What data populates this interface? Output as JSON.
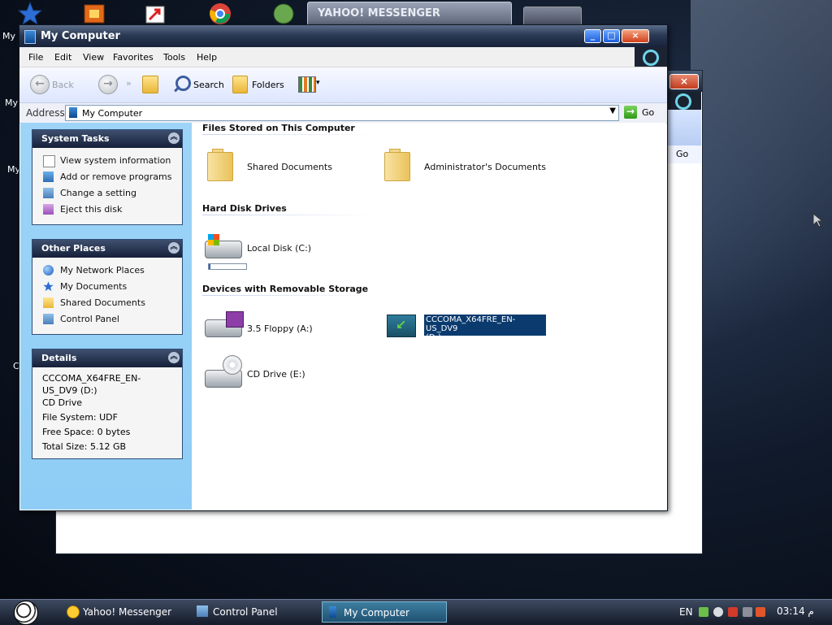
{
  "desktop": {
    "labels": [
      "My I",
      "My",
      "My",
      "C"
    ],
    "ym_tab": "YAHOO! MESSENGER"
  },
  "window": {
    "title": "My Computer",
    "controls": {
      "minimize": "_",
      "maximize": "□",
      "close": "×"
    }
  },
  "menu": [
    "File",
    "Edit",
    "View",
    "Favorites",
    "Tools",
    "Help"
  ],
  "toolbar": {
    "back": "Back",
    "forward": "»",
    "search": "Search",
    "folders": "Folders"
  },
  "address": {
    "label": "Address",
    "value": "My Computer",
    "go": "Go"
  },
  "system_tasks": {
    "title": "System Tasks",
    "items": [
      "View system information",
      "Add or remove programs",
      "Change a setting",
      "Eject this disk"
    ]
  },
  "other_places": {
    "title": "Other Places",
    "items": [
      "My Network Places",
      "My Documents",
      "Shared Documents",
      "Control Panel"
    ]
  },
  "details": {
    "title": "Details",
    "name": "CCCOMA_X64FRE_EN-US_DV9 (D:)",
    "type": "CD Drive",
    "file_system": "File System: UDF",
    "free_space": "Free Space: 0 bytes",
    "total_size": "Total Size: 5.12 GB"
  },
  "sections": {
    "files": "Files Stored on This Computer",
    "hdd": "Hard Disk Drives",
    "removable": "Devices with Removable Storage"
  },
  "items": {
    "shared_docs": "Shared Documents",
    "admin_docs": "Administrator's Documents",
    "local_disk": "Local Disk (C:)",
    "local_disk_used_fraction": 0.05,
    "floppy": "3.5 Floppy (A:)",
    "usb_line1": "CCCOMA_X64FRE_EN-US_DV9",
    "usb_line2": "(D:)",
    "cd_drive": "CD Drive (E:)"
  },
  "taskbar": {
    "items": [
      "Yahoo! Messenger",
      "Control Panel",
      "My Computer"
    ],
    "language": "EN",
    "clock": "03:14",
    "tray_suffix": "م"
  },
  "colors": {
    "accent": "#2b62c8",
    "left_pane": "#9dd4f7",
    "selection": "#0b3b6e"
  }
}
